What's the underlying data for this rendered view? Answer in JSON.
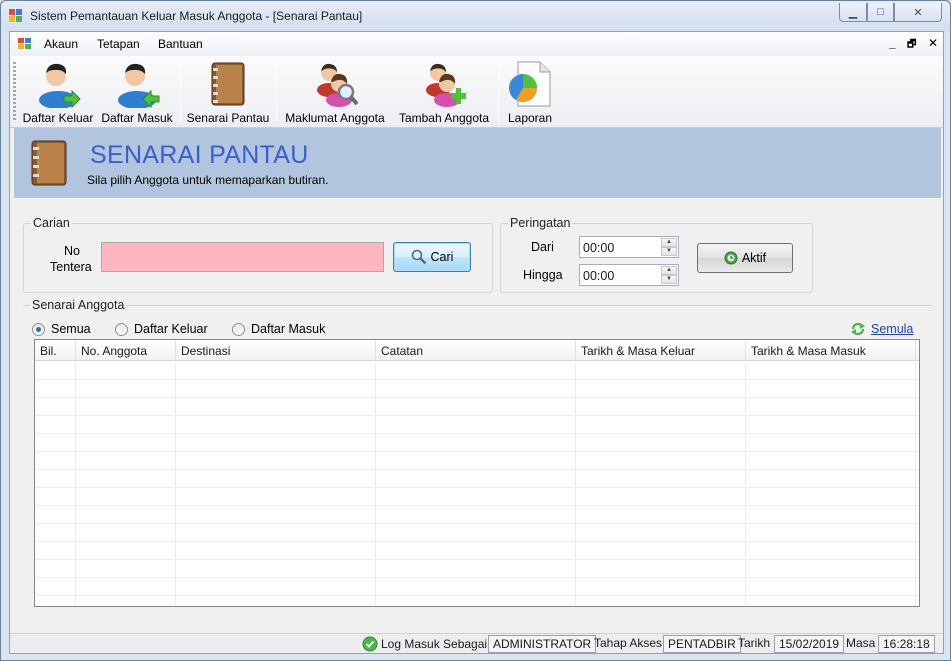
{
  "window": {
    "title": "Sistem Pemantauan Keluar Masuk Anggota - [Senarai Pantau]",
    "controls": {
      "minimize": "▁",
      "maximize": "□",
      "close": "✕"
    }
  },
  "menu": {
    "items": [
      "Akaun",
      "Tetapan",
      "Bantuan"
    ],
    "mdi": {
      "minimize": "_",
      "restore": "🗗",
      "close": "✕"
    }
  },
  "toolbar": {
    "items": [
      {
        "label": "Daftar Keluar",
        "icon": "user-exit-icon"
      },
      {
        "label": "Daftar Masuk",
        "icon": "user-enter-icon"
      },
      {
        "label": "Senarai Pantau",
        "icon": "book-icon"
      },
      {
        "label": "Maklumat Anggota",
        "icon": "users-search-icon"
      },
      {
        "label": "Tambah Anggota",
        "icon": "user-add-icon"
      },
      {
        "label": "Laporan",
        "icon": "report-chart-icon"
      }
    ]
  },
  "banner": {
    "title": "SENARAI PANTAU",
    "subtitle": "Sila pilih Anggota untuk memaparkan butiran."
  },
  "search": {
    "group_title": "Carian",
    "label": "No\nTentera",
    "label_line1": "No",
    "label_line2": "Tentera",
    "value": "",
    "button": "Cari"
  },
  "alert": {
    "group_title": "Peringatan",
    "from_label": "Dari",
    "from_value": "00:00",
    "to_label": "Hingga",
    "to_value": "00:00",
    "button": "Aktif"
  },
  "list": {
    "group_title": "Senarai Anggota",
    "filters": [
      {
        "label": "Semua",
        "selected": true
      },
      {
        "label": "Daftar Keluar",
        "selected": false
      },
      {
        "label": "Daftar Masuk",
        "selected": false
      }
    ],
    "reset_link": "Semula",
    "columns": [
      "Bil.",
      "No. Anggota",
      "Destinasi",
      "Catatan",
      "Tarikh & Masa Keluar",
      "Tarikh & Masa Masuk"
    ],
    "rows": []
  },
  "status": {
    "login_label": "Log Masuk Sebagai",
    "login_value": "ADMINISTRATOR",
    "access_label": "Tahap Akses",
    "access_value": "PENTADBIR",
    "date_label": "Tarikh",
    "date_value": "15/02/2019",
    "time_label": "Masa",
    "time_value": "16:28:18"
  },
  "colors": {
    "banner_bg": "#b1c5df",
    "banner_title": "#3a5fc8",
    "search_input_bg": "#ffb6c1",
    "link": "#1a3fd1"
  }
}
